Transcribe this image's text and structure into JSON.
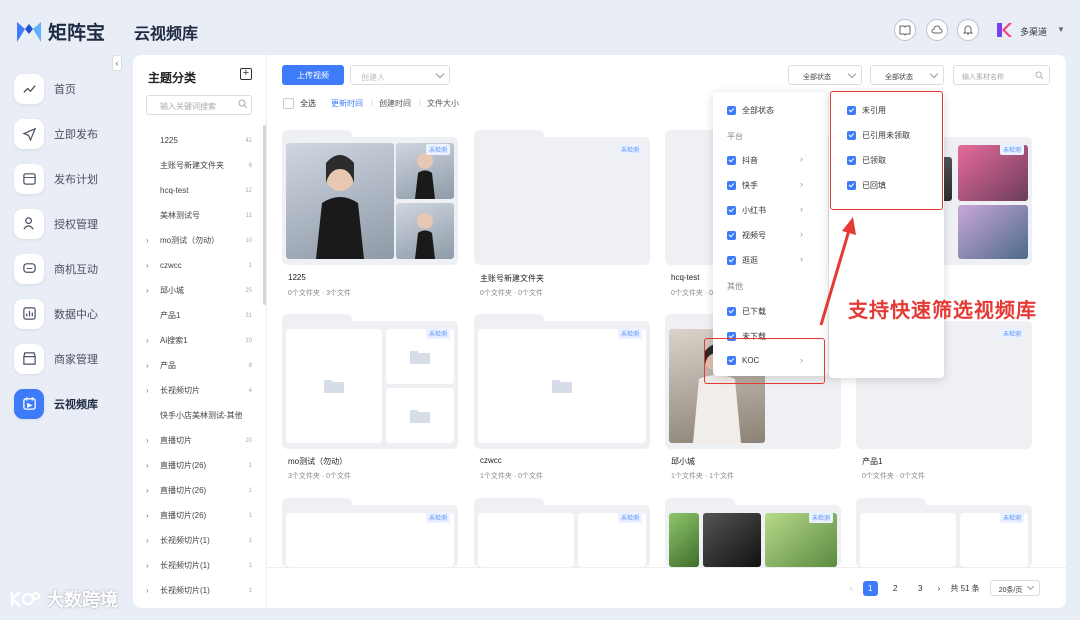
{
  "app": {
    "name": "矩阵宝",
    "page_title": "云视频库",
    "brand_color": "#3e7bfa"
  },
  "nav": [
    {
      "label": "首页",
      "icon": "chart-line-icon"
    },
    {
      "label": "立即发布",
      "icon": "send-icon"
    },
    {
      "label": "发布计划",
      "icon": "calendar-icon"
    },
    {
      "label": "授权管理",
      "icon": "user-auth-icon"
    },
    {
      "label": "商机互动",
      "icon": "chat-icon"
    },
    {
      "label": "数据中心",
      "icon": "bar-chart-icon"
    },
    {
      "label": "商家管理",
      "icon": "store-icon"
    },
    {
      "label": "云视频库",
      "icon": "video-library-icon",
      "active": true
    }
  ],
  "header": {
    "user_name": "多渠道"
  },
  "categories": {
    "title": "主题分类",
    "search_placeholder": "输入关键词搜索",
    "items": [
      {
        "name": "1225",
        "count": "42",
        "expandable": false
      },
      {
        "name": "主账号新建文件夹",
        "count": "6",
        "expandable": false
      },
      {
        "name": "hcq-test",
        "count": "12",
        "expandable": false
      },
      {
        "name": "美林测试号",
        "count": "11",
        "expandable": false
      },
      {
        "name": "mo测试（勿动）",
        "count": "10",
        "expandable": true
      },
      {
        "name": "czwcc",
        "count": "1",
        "expandable": true
      },
      {
        "name": "邱小城",
        "count": "25",
        "expandable": true
      },
      {
        "name": "产品1",
        "count": "31",
        "expandable": false
      },
      {
        "name": "Ai搜索1",
        "count": "10",
        "expandable": true
      },
      {
        "name": "产品",
        "count": "8",
        "expandable": true
      },
      {
        "name": "长视频切片",
        "count": "4",
        "expandable": true
      },
      {
        "name": "快手小店美林测试-其他",
        "count": "",
        "expandable": false
      },
      {
        "name": "直播切片",
        "count": "20",
        "expandable": true
      },
      {
        "name": "直播切片(26)",
        "count": "1",
        "expandable": true
      },
      {
        "name": "直播切片(26)",
        "count": "1",
        "expandable": true
      },
      {
        "name": "直播切片(26)",
        "count": "1",
        "expandable": true
      },
      {
        "name": "长视频切片(1)",
        "count": "1",
        "expandable": true
      },
      {
        "name": "长视频切片(1)",
        "count": "1",
        "expandable": true
      },
      {
        "name": "长视频切片(1)",
        "count": "1",
        "expandable": true
      }
    ]
  },
  "toolbar": {
    "upload_label": "上传视频",
    "creator_placeholder": "创建人",
    "filter1_label": "全部状态",
    "filter2_label": "全部状态",
    "search_placeholder": "输入素材名称",
    "check_all_label": "全选",
    "sort_update": "更新时间",
    "sort_create": "创建时间",
    "sort_size": "文件大小"
  },
  "badge_text": "未检测",
  "cards": [
    {
      "title": "1225",
      "sub": "0个文件夹 · 3个文件"
    },
    {
      "title": "主账号新建文件夹",
      "sub": "0个文件夹 · 0个文件"
    },
    {
      "title": "hcq-test",
      "sub": "0个文件夹 · 0个文件"
    },
    {
      "title": "",
      "sub": ""
    },
    {
      "title": "mo测试（勿动）",
      "sub": "3个文件夹 · 0个文件"
    },
    {
      "title": "czwcc",
      "sub": "1个文件夹 · 0个文件"
    },
    {
      "title": "邱小城",
      "sub": "1个文件夹 · 1个文件"
    },
    {
      "title": "产品1",
      "sub": "0个文件夹 · 0个文件"
    }
  ],
  "dropdown": {
    "all_status": "全部状态",
    "platform_group": "平台",
    "platforms": [
      "抖音",
      "快手",
      "小红书",
      "视频号",
      "逛逛"
    ],
    "other_group": "其他",
    "others": [
      "已下载",
      "未下载",
      "KOC"
    ],
    "sub_options": [
      "未引用",
      "已引用未领取",
      "已领取",
      "已回填"
    ]
  },
  "annotation": "支持快速筛选视频库",
  "pagination": {
    "pages": [
      "1",
      "2",
      "3"
    ],
    "current": "1",
    "total": "共 51 条",
    "page_size": "20条/页"
  },
  "watermark": "大数跨境"
}
